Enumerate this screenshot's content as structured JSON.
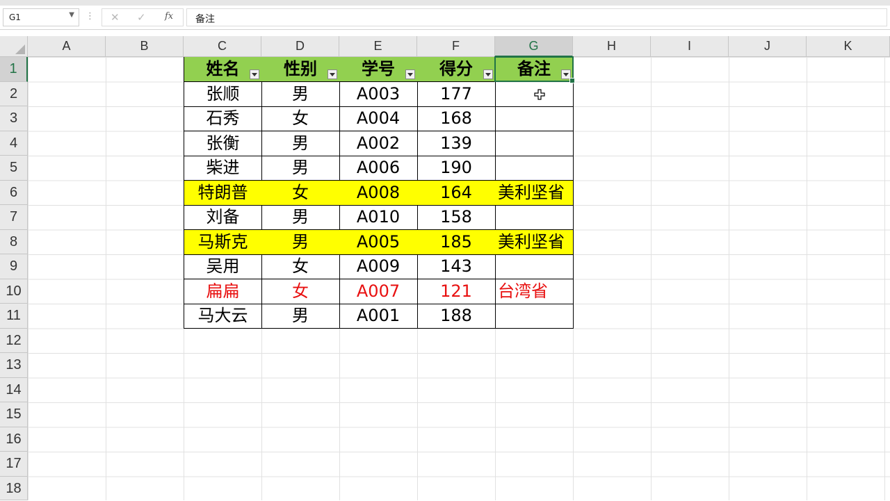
{
  "formula_bar": {
    "name_box": "G1",
    "cancel_icon": "✕",
    "enter_icon": "✓",
    "fx_label": "fx",
    "content": "备注"
  },
  "columns": [
    "A",
    "B",
    "C",
    "D",
    "E",
    "F",
    "G",
    "H",
    "I",
    "J",
    "K"
  ],
  "selected_column": "G",
  "rows": [
    "1",
    "2",
    "3",
    "4",
    "5",
    "6",
    "7",
    "8",
    "9",
    "10",
    "11",
    "12",
    "13",
    "14",
    "15",
    "16",
    "17",
    "18"
  ],
  "selected_row": "1",
  "table": {
    "headers": [
      "姓名",
      "性别",
      "学号",
      "得分",
      "备注"
    ],
    "records": [
      {
        "name": "张顺",
        "gender": "男",
        "id": "A003",
        "score": "177",
        "note": "",
        "style": "normal"
      },
      {
        "name": "石秀",
        "gender": "女",
        "id": "A004",
        "score": "168",
        "note": "",
        "style": "normal"
      },
      {
        "name": "张衡",
        "gender": "男",
        "id": "A002",
        "score": "139",
        "note": "",
        "style": "normal"
      },
      {
        "name": "柴进",
        "gender": "男",
        "id": "A006",
        "score": "190",
        "note": "",
        "style": "normal"
      },
      {
        "name": "特朗普",
        "gender": "女",
        "id": "A008",
        "score": "164",
        "note": "美利坚省",
        "style": "yellow"
      },
      {
        "name": "刘备",
        "gender": "男",
        "id": "A010",
        "score": "158",
        "note": "",
        "style": "normal"
      },
      {
        "name": "马斯克",
        "gender": "男",
        "id": "A005",
        "score": "185",
        "note": "美利坚省",
        "style": "yellow"
      },
      {
        "name": "吴用",
        "gender": "女",
        "id": "A009",
        "score": "143",
        "note": "",
        "style": "normal"
      },
      {
        "name": "扁扁",
        "gender": "女",
        "id": "A007",
        "score": "121",
        "note": "台湾省",
        "style": "red"
      },
      {
        "name": "马大云",
        "gender": "男",
        "id": "A001",
        "score": "188",
        "note": "",
        "style": "normal"
      }
    ]
  },
  "colors": {
    "header_fill": "#92d050",
    "highlight_fill": "#ffff00",
    "red_text": "#e81010",
    "selection": "#217346"
  }
}
